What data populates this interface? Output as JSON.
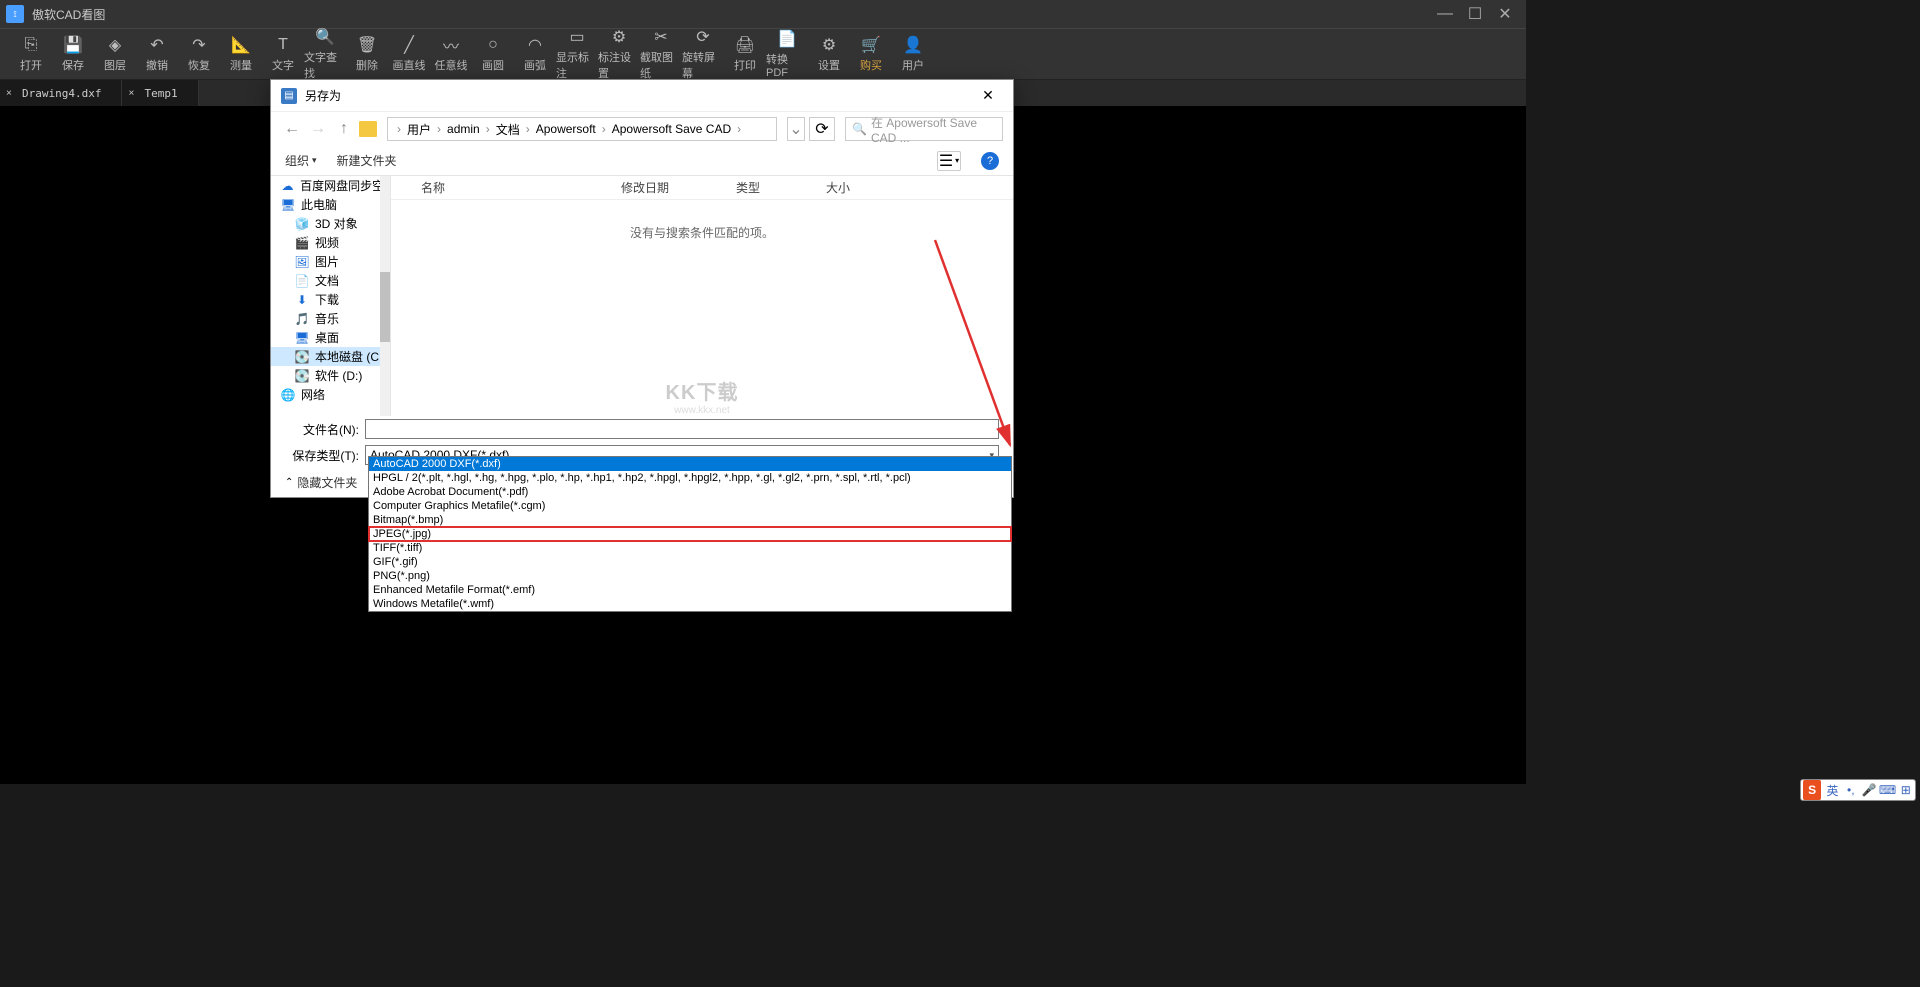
{
  "app": {
    "title": "傲软CAD看图"
  },
  "toolbar": [
    {
      "label": "打开",
      "icon": "⎘",
      "name": "open-button"
    },
    {
      "label": "保存",
      "icon": "💾",
      "name": "save-button"
    },
    {
      "label": "图层",
      "icon": "◈",
      "name": "layers-button"
    },
    {
      "label": "撤销",
      "icon": "↶",
      "name": "undo-button"
    },
    {
      "label": "恢复",
      "icon": "↷",
      "name": "redo-button"
    },
    {
      "label": "测量",
      "icon": "📐",
      "name": "measure-button"
    },
    {
      "label": "文字",
      "icon": "T",
      "name": "text-button"
    },
    {
      "label": "文字查找",
      "icon": "🔍",
      "name": "find-text-button"
    },
    {
      "label": "删除",
      "icon": "🗑",
      "name": "delete-button"
    },
    {
      "label": "画直线",
      "icon": "╱",
      "name": "line-button"
    },
    {
      "label": "任意线",
      "icon": "〰",
      "name": "polyline-button"
    },
    {
      "label": "画圆",
      "icon": "○",
      "name": "circle-button"
    },
    {
      "label": "画弧",
      "icon": "◠",
      "name": "arc-button"
    },
    {
      "label": "显示标注",
      "icon": "▭",
      "name": "show-dimension-button"
    },
    {
      "label": "标注设置",
      "icon": "⚙",
      "name": "dimension-settings-button"
    },
    {
      "label": "截取图纸",
      "icon": "✂",
      "name": "crop-button"
    },
    {
      "label": "旋转屏幕",
      "icon": "⟳",
      "name": "rotate-button"
    },
    {
      "label": "打印",
      "icon": "🖨",
      "name": "print-button"
    },
    {
      "label": "转换PDF",
      "icon": "📄",
      "name": "to-pdf-button"
    },
    {
      "label": "设置",
      "icon": "⚙",
      "name": "settings-button"
    },
    {
      "label": "购买",
      "icon": "🛒",
      "name": "buy-button",
      "buy": true
    },
    {
      "label": "用户",
      "icon": "👤",
      "name": "user-button"
    }
  ],
  "tabs": [
    {
      "name": "Drawing4.dxf"
    },
    {
      "name": "Temp1"
    }
  ],
  "dialog": {
    "title": "另存为",
    "breadcrumb": [
      "用户",
      "admin",
      "文档",
      "Apowersoft",
      "Apowersoft Save CAD"
    ],
    "search_placeholder": "在 Apowersoft Save CAD ...",
    "organize": "组织",
    "new_folder": "新建文件夹",
    "columns": {
      "name": "名称",
      "date": "修改日期",
      "type": "类型",
      "size": "大小"
    },
    "empty": "没有与搜索条件匹配的项。",
    "sidebar": [
      {
        "label": "百度网盘同步空间",
        "icon": "☁",
        "color": "#1a6dd6"
      },
      {
        "label": "此电脑",
        "icon": "🖥",
        "color": "#1a6dd6"
      },
      {
        "label": "3D 对象",
        "icon": "🧊",
        "color": "#3aa9b5",
        "indent": true
      },
      {
        "label": "视频",
        "icon": "🎬",
        "color": "#1a6dd6",
        "indent": true
      },
      {
        "label": "图片",
        "icon": "🖼",
        "color": "#1a6dd6",
        "indent": true
      },
      {
        "label": "文档",
        "icon": "📄",
        "color": "#1a6dd6",
        "indent": true
      },
      {
        "label": "下载",
        "icon": "⬇",
        "color": "#1a6dd6",
        "indent": true
      },
      {
        "label": "音乐",
        "icon": "🎵",
        "color": "#1a6dd6",
        "indent": true
      },
      {
        "label": "桌面",
        "icon": "🖥",
        "color": "#1a6dd6",
        "indent": true
      },
      {
        "label": "本地磁盘 (C:)",
        "icon": "💽",
        "color": "#888",
        "indent": true,
        "selected": true
      },
      {
        "label": "软件 (D:)",
        "icon": "💽",
        "color": "#888",
        "indent": true
      },
      {
        "label": "网络",
        "icon": "🌐",
        "color": "#1a6dd6"
      }
    ],
    "filename_label": "文件名(N):",
    "filetype_label": "保存类型(T):",
    "filetype_selected": "AutoCAD 2000 DXF(*.dxf)",
    "hide_folders": "隐藏文件夹",
    "dropdown": [
      {
        "text": "AutoCAD 2000 DXF(*.dxf)",
        "selected": true
      },
      {
        "text": "HPGL / 2(*.plt, *.hgl, *.hg, *.hpg, *.plo, *.hp, *.hp1, *.hp2, *.hpgl, *.hpgl2, *.hpp, *.gl, *.gl2, *.prn, *.spl, *.rtl, *.pcl)"
      },
      {
        "text": "Adobe Acrobat Document(*.pdf)"
      },
      {
        "text": "Computer Graphics Metafile(*.cgm)"
      },
      {
        "text": "Bitmap(*.bmp)"
      },
      {
        "text": "JPEG(*.jpg)",
        "boxed": true
      },
      {
        "text": "TIFF(*.tiff)"
      },
      {
        "text": "GIF(*.gif)"
      },
      {
        "text": "PNG(*.png)"
      },
      {
        "text": "Enhanced Metafile Format(*.emf)"
      },
      {
        "text": "Windows Metafile(*.wmf)"
      }
    ]
  },
  "watermark": {
    "line1": "KK下载",
    "line2": "www.kkx.net"
  },
  "ime": {
    "lang": "英"
  }
}
